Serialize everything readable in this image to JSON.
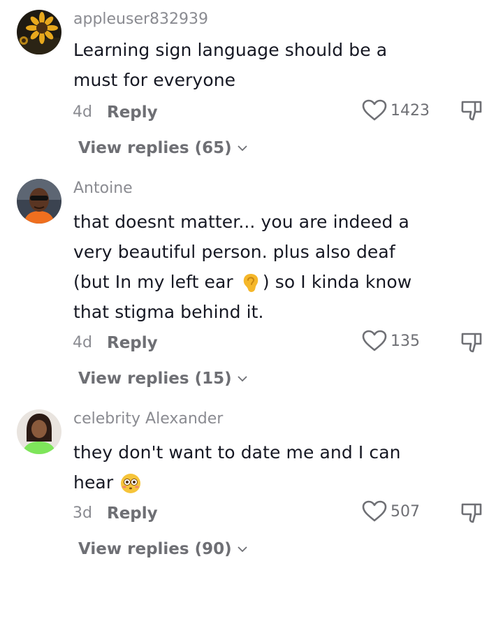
{
  "comments": [
    {
      "username": "appleuser832939",
      "line1": "Learning sign language should be a",
      "line2": "must for everyone",
      "age": "4d",
      "reply_label": "Reply",
      "likes": "1423",
      "view_replies": "View replies (65)",
      "avatar": "sunflower-avatar"
    },
    {
      "username": "Antoine",
      "line1": "that doesnt matter... you are indeed a",
      "line2": "very beautiful person. plus also deaf",
      "line3a": "(but In my left ear ",
      "line3b": ") so I kinda know",
      "line4": "that stigma behind it.",
      "emoji": "ear-emoji",
      "age": "4d",
      "reply_label": "Reply",
      "likes": "135",
      "view_replies": "View replies (15)",
      "avatar": "man-sunglasses-avatar"
    },
    {
      "username": "celebrity Alexander",
      "line1": "they don't want to date me and I can",
      "line2a": "hear ",
      "emoji": "flushed-face-emoji",
      "age": "3d",
      "reply_label": "Reply",
      "likes": "507",
      "view_replies": "View replies (90)",
      "avatar": "woman-avatar"
    }
  ],
  "colors": {
    "primary_text": "#161823",
    "secondary_text": "#8a8b91",
    "action_text": "#6e6f74"
  }
}
